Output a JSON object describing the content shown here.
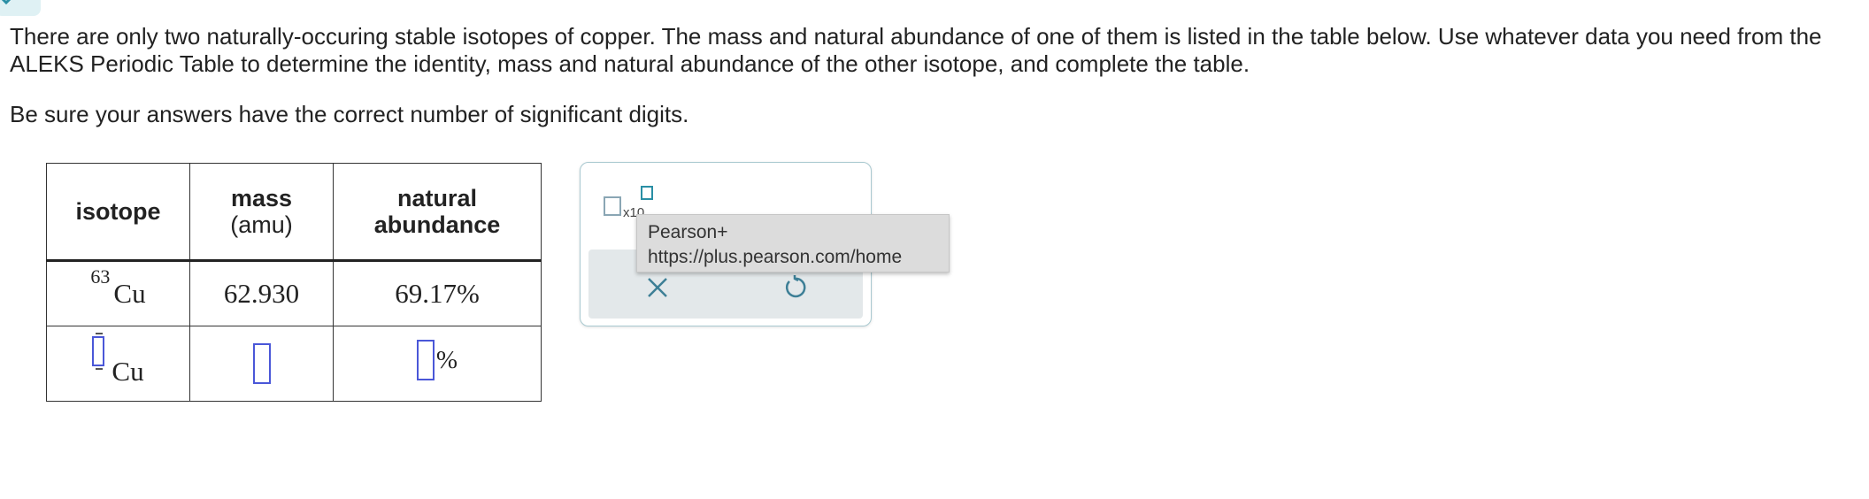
{
  "question": {
    "prompt": "There are only two naturally-occuring stable isotopes of copper. The mass and natural abundance of one of them is listed in the table below. Use whatever data you need from the ALEKS Periodic Table to determine the identity, mass and natural abundance of the other isotope, and complete the table.",
    "note": "Be sure your answers have the correct number of significant digits."
  },
  "table": {
    "headers": {
      "isotope": "isotope",
      "mass": "mass",
      "mass_unit": "(amu)",
      "abundance_line1": "natural",
      "abundance_line2": "abundance"
    },
    "rows": [
      {
        "mass_number": "63",
        "symbol": "Cu",
        "mass": "62.930",
        "abundance": "69.17%"
      },
      {
        "mass_number": "",
        "symbol": "Cu",
        "mass": "",
        "abundance": "",
        "abundance_unit": "%"
      }
    ]
  },
  "palette": {
    "x10_label": "x10",
    "clear_icon": "x-icon",
    "undo_icon": "undo-icon"
  },
  "tooltip": {
    "title": "Pearson+",
    "url": "https://plus.pearson.com/home"
  },
  "colors": {
    "input_border": "#4a57d8",
    "palette_border": "#a9c9d0",
    "accent": "#2a8fa5"
  }
}
